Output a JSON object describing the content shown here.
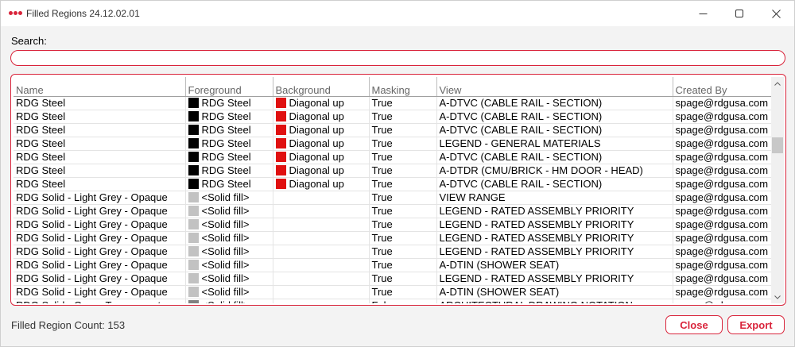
{
  "window": {
    "title": "Filled Regions 24.12.02.01",
    "accent": "#d9243b",
    "controls": [
      "minimize-icon",
      "maximize-icon",
      "close-icon"
    ]
  },
  "search": {
    "label": "Search:",
    "value": "",
    "placeholder": ""
  },
  "table": {
    "columns": [
      "Name",
      "Foreground",
      "Background",
      "Masking",
      "View",
      "Created By"
    ],
    "rows": [
      {
        "name": "RDG Steel",
        "fg_color": "black",
        "fg": "RDG Steel",
        "bg_color": "red",
        "bg": "Diagonal up",
        "masking": "True",
        "view": "A-DTVC (CABLE RAIL - SECTION)",
        "created_by": "spage@rdgusa.com"
      },
      {
        "name": "RDG Steel",
        "fg_color": "black",
        "fg": "RDG Steel",
        "bg_color": "red",
        "bg": "Diagonal up",
        "masking": "True",
        "view": "A-DTVC (CABLE RAIL - SECTION)",
        "created_by": "spage@rdgusa.com"
      },
      {
        "name": "RDG Steel",
        "fg_color": "black",
        "fg": "RDG Steel",
        "bg_color": "red",
        "bg": "Diagonal up",
        "masking": "True",
        "view": "A-DTVC (CABLE RAIL - SECTION)",
        "created_by": "spage@rdgusa.com"
      },
      {
        "name": "RDG Steel",
        "fg_color": "black",
        "fg": "RDG Steel",
        "bg_color": "red",
        "bg": "Diagonal up",
        "masking": "True",
        "view": "LEGEND - GENERAL MATERIALS",
        "created_by": "spage@rdgusa.com"
      },
      {
        "name": "RDG Steel",
        "fg_color": "black",
        "fg": "RDG Steel",
        "bg_color": "red",
        "bg": "Diagonal up",
        "masking": "True",
        "view": "A-DTVC (CABLE RAIL - SECTION)",
        "created_by": "spage@rdgusa.com"
      },
      {
        "name": "RDG Steel",
        "fg_color": "black",
        "fg": "RDG Steel",
        "bg_color": "red",
        "bg": "Diagonal up",
        "masking": "True",
        "view": "A-DTDR (CMU/BRICK - HM DOOR - HEAD)",
        "created_by": "spage@rdgusa.com"
      },
      {
        "name": "RDG Steel",
        "fg_color": "black",
        "fg": "RDG Steel",
        "bg_color": "red",
        "bg": "Diagonal up",
        "masking": "True",
        "view": "A-DTVC (CABLE RAIL - SECTION)",
        "created_by": "spage@rdgusa.com"
      },
      {
        "name": "RDG Solid - Light Grey - Opaque",
        "fg_color": "grey",
        "fg": "<Solid fill>",
        "bg_color": "",
        "bg": "",
        "masking": "True",
        "view": "VIEW RANGE",
        "created_by": "spage@rdgusa.com"
      },
      {
        "name": "RDG Solid - Light Grey - Opaque",
        "fg_color": "grey",
        "fg": "<Solid fill>",
        "bg_color": "",
        "bg": "",
        "masking": "True",
        "view": "LEGEND - RATED ASSEMBLY PRIORITY",
        "created_by": "spage@rdgusa.com"
      },
      {
        "name": "RDG Solid - Light Grey - Opaque",
        "fg_color": "grey",
        "fg": "<Solid fill>",
        "bg_color": "",
        "bg": "",
        "masking": "True",
        "view": "LEGEND - RATED ASSEMBLY PRIORITY",
        "created_by": "spage@rdgusa.com"
      },
      {
        "name": "RDG Solid - Light Grey - Opaque",
        "fg_color": "grey",
        "fg": "<Solid fill>",
        "bg_color": "",
        "bg": "",
        "masking": "True",
        "view": "LEGEND - RATED ASSEMBLY PRIORITY",
        "created_by": "spage@rdgusa.com"
      },
      {
        "name": "RDG Solid - Light Grey - Opaque",
        "fg_color": "grey",
        "fg": "<Solid fill>",
        "bg_color": "",
        "bg": "",
        "masking": "True",
        "view": "LEGEND - RATED ASSEMBLY PRIORITY",
        "created_by": "spage@rdgusa.com"
      },
      {
        "name": "RDG Solid - Light Grey - Opaque",
        "fg_color": "grey",
        "fg": "<Solid fill>",
        "bg_color": "",
        "bg": "",
        "masking": "True",
        "view": "A-DTIN (SHOWER SEAT)",
        "created_by": "spage@rdgusa.com"
      },
      {
        "name": "RDG Solid - Light Grey - Opaque",
        "fg_color": "grey",
        "fg": "<Solid fill>",
        "bg_color": "",
        "bg": "",
        "masking": "True",
        "view": "LEGEND - RATED ASSEMBLY PRIORITY",
        "created_by": "spage@rdgusa.com"
      },
      {
        "name": "RDG Solid - Light Grey - Opaque",
        "fg_color": "grey",
        "fg": "<Solid fill>",
        "bg_color": "",
        "bg": "",
        "masking": "True",
        "view": "A-DTIN (SHOWER SEAT)",
        "created_by": "spage@rdgusa.com"
      },
      {
        "name": "RDG Solid - Grey - Transparent",
        "fg_color": "darkgrey",
        "fg": "<Solid fill>",
        "bg_color": "",
        "bg": "",
        "masking": "False",
        "view": "ARCHITECTURAL DRAWING NOTATION",
        "created_by": "spage@rdgusa.com"
      }
    ]
  },
  "footer": {
    "count_text": "Filled Region Count: 153",
    "close_label": "Close",
    "export_label": "Export"
  }
}
